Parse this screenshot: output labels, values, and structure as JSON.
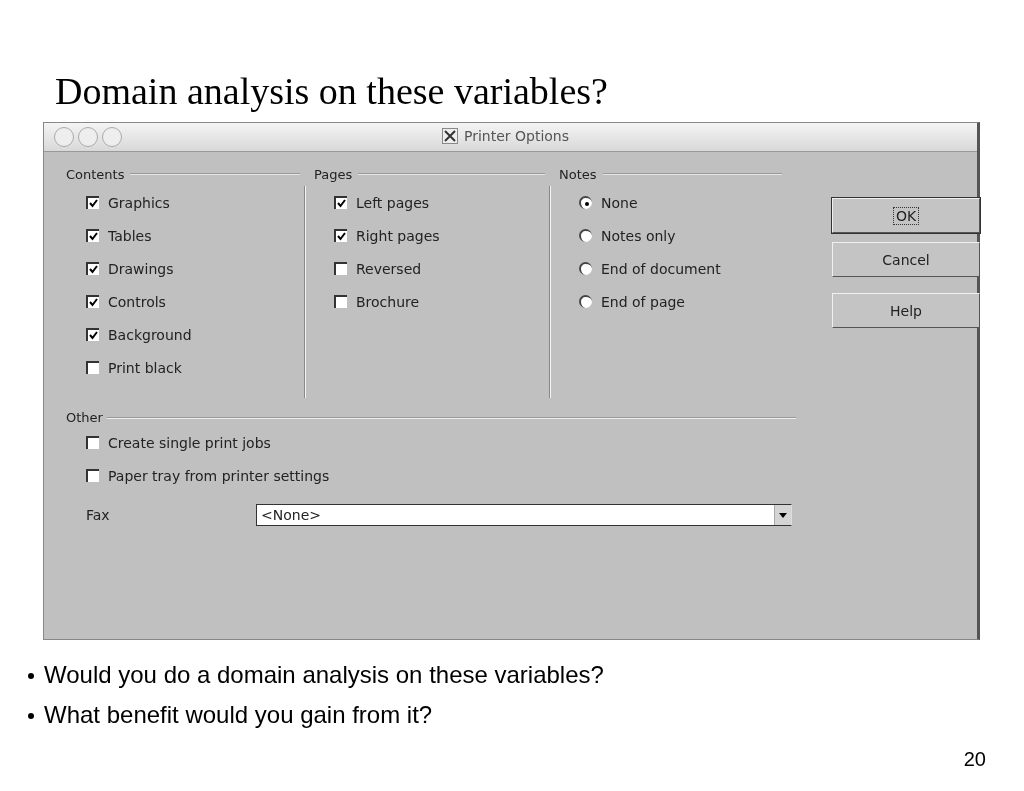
{
  "slide": {
    "title": "Domain analysis on these variables?",
    "page_number": "20"
  },
  "window": {
    "title": "Printer Options"
  },
  "groups": [
    {
      "title": "Contents",
      "kind": "checkbox",
      "items": [
        {
          "label": "Graphics",
          "checked": true
        },
        {
          "label": "Tables",
          "checked": true
        },
        {
          "label": "Drawings",
          "checked": true
        },
        {
          "label": "Controls",
          "checked": true
        },
        {
          "label": "Background",
          "checked": true
        },
        {
          "label": "Print black",
          "checked": false
        }
      ]
    },
    {
      "title": "Pages",
      "kind": "checkbox",
      "items": [
        {
          "label": "Left pages",
          "checked": true
        },
        {
          "label": "Right pages",
          "checked": true
        },
        {
          "label": "Reversed",
          "checked": false
        },
        {
          "label": "Brochure",
          "checked": false
        }
      ]
    },
    {
      "title": "Notes",
      "kind": "radio",
      "items": [
        {
          "label": "None",
          "selected": true
        },
        {
          "label": "Notes only",
          "selected": false
        },
        {
          "label": "End of document",
          "selected": false
        },
        {
          "label": "End of page",
          "selected": false
        }
      ]
    }
  ],
  "other": {
    "title": "Other",
    "items": [
      {
        "label": "Create single print jobs",
        "checked": false
      },
      {
        "label": "Paper tray from printer settings",
        "checked": false
      }
    ],
    "fax": {
      "label": "Fax",
      "value": "<None>"
    }
  },
  "buttons": [
    {
      "label": "OK",
      "default": true
    },
    {
      "label": "Cancel",
      "default": false
    },
    {
      "label": "Help",
      "default": false
    }
  ],
  "bullets": [
    "Would you do a domain analysis on these variables?",
    "What benefit would you gain from it?"
  ]
}
